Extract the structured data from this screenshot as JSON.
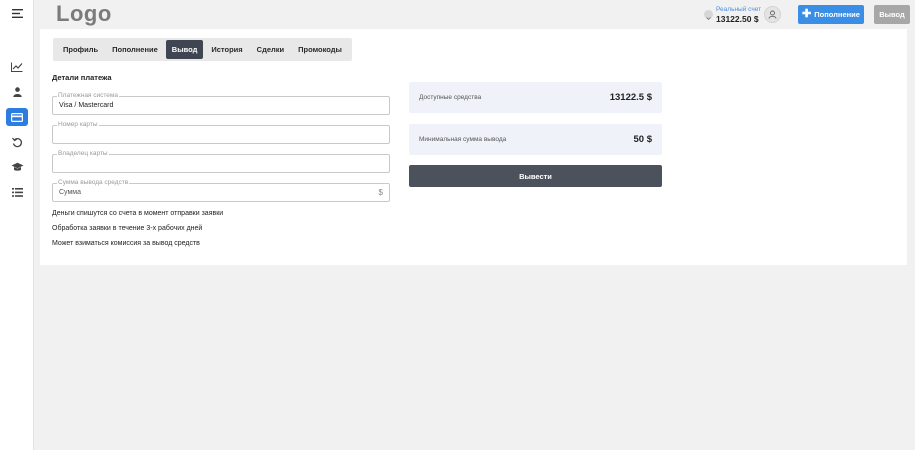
{
  "header": {
    "logo": "Logo",
    "account": {
      "label": "Реальный счет",
      "balance": "13122.50 $"
    },
    "deposit_label": "Пополнение",
    "withdraw_label": "Вывод"
  },
  "sidebar": {
    "items": [
      {
        "icon": "chart-line-icon"
      },
      {
        "icon": "user-icon"
      },
      {
        "icon": "credit-card-icon",
        "active": true
      },
      {
        "icon": "history-icon"
      },
      {
        "icon": "graduation-cap-icon"
      },
      {
        "icon": "list-icon"
      }
    ]
  },
  "tabs": [
    {
      "label": "Профиль"
    },
    {
      "label": "Пополнение"
    },
    {
      "label": "Вывод",
      "active": true
    },
    {
      "label": "История"
    },
    {
      "label": "Сделки"
    },
    {
      "label": "Промокоды"
    }
  ],
  "form": {
    "title": "Детали платежа",
    "payment_system": {
      "label": "Платежная система",
      "value": "Visa / Mastercard"
    },
    "card_number": {
      "label": "Номер карты",
      "value": ""
    },
    "card_holder": {
      "label": "Владелец карты",
      "value": ""
    },
    "amount": {
      "label": "Сумма вывода средств",
      "placeholder": "Сумма",
      "suffix": "$"
    }
  },
  "notes": [
    "Деньги спишутся со счета в момент отправки заявки",
    "Обработка заявки в течение 3-х рабочих дней",
    "Может взиматься комиссия за вывод средств"
  ],
  "info": {
    "available": {
      "label": "Доступные средства",
      "value": "13122.5 $"
    },
    "minimum": {
      "label": "Минимальная сумма вывода",
      "value": "50 $"
    }
  },
  "submit_label": "Вывести",
  "colors": {
    "accent": "#3a8ee6",
    "active_tab": "#3f4651",
    "submit": "#4b525c",
    "info_bg": "#eff3f9"
  }
}
